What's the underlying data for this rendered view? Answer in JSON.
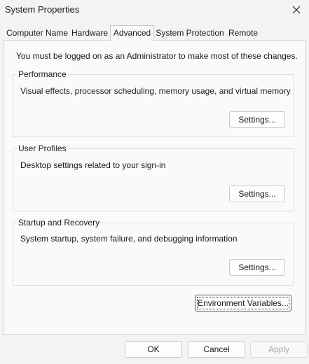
{
  "window": {
    "title": "System Properties",
    "close_icon": "close-icon"
  },
  "tabs": [
    {
      "label": "Computer Name"
    },
    {
      "label": "Hardware"
    },
    {
      "label": "Advanced",
      "active": true
    },
    {
      "label": "System Protection"
    },
    {
      "label": "Remote"
    }
  ],
  "advanced": {
    "admin_note": "You must be logged on as an Administrator to make most of these changes.",
    "performance": {
      "title": "Performance",
      "description": "Visual effects, processor scheduling, memory usage, and virtual memory",
      "button": "Settings..."
    },
    "user_profiles": {
      "title": "User Profiles",
      "description": "Desktop settings related to your sign-in",
      "button": "Settings..."
    },
    "startup_recovery": {
      "title": "Startup and Recovery",
      "description": "System startup, system failure, and debugging information",
      "button": "Settings..."
    },
    "environment_variables_button": "Environment Variables..."
  },
  "footer": {
    "ok": "OK",
    "cancel": "Cancel",
    "apply": "Apply"
  }
}
